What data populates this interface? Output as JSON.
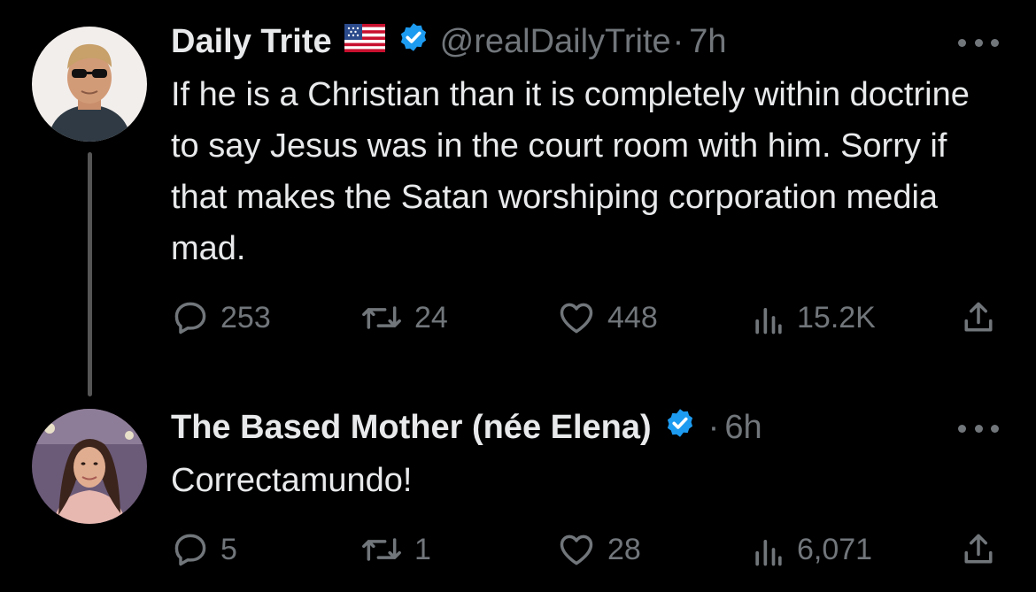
{
  "colors": {
    "background": "#000000",
    "text_primary": "#e7e9ea",
    "text_secondary": "#71767b",
    "verified_blue": "#1d9bf0"
  },
  "tweets": [
    {
      "author_name": "Daily Trite",
      "flag": "us-flag-icon",
      "verified": true,
      "handle": "@realDailyTrite",
      "separator": "·",
      "time": "7h",
      "text": "If he is a Christian than it is completely within doctrine to say Jesus was in the court room with him. Sorry if that makes the Satan worshiping corporation media mad.",
      "stats": {
        "replies": "253",
        "retweets": "24",
        "likes": "448",
        "views": "15.2K"
      }
    },
    {
      "author_name": "The Based Mother (née Elena)",
      "verified": true,
      "separator": "·",
      "time": "6h",
      "text": "Correctamundo!",
      "stats": {
        "replies": "5",
        "retweets": "1",
        "likes": "28",
        "views": "6,071"
      }
    }
  ]
}
